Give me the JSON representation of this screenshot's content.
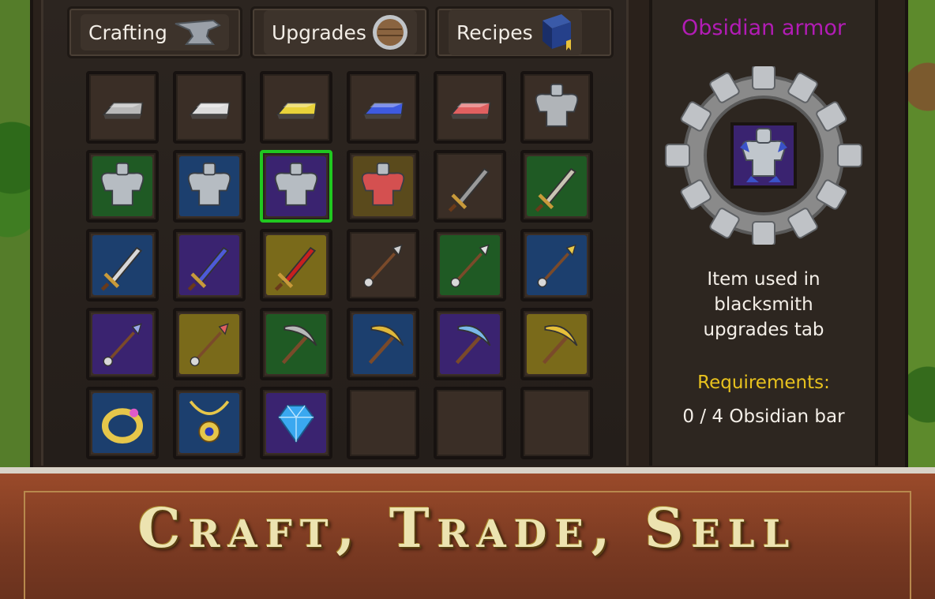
{
  "tabs": [
    {
      "label": "Crafting",
      "icon": "anvil-icon"
    },
    {
      "label": "Upgrades",
      "icon": "shield-icon"
    },
    {
      "label": "Recipes",
      "icon": "book-icon"
    }
  ],
  "grid": [
    [
      {
        "icon": "silver-bar-icon",
        "bg": "#3a2e26",
        "color": "#b8b8b8"
      },
      {
        "icon": "iron-bar-icon",
        "bg": "#3a2e26",
        "color": "#dcdcdc"
      },
      {
        "icon": "gold-bar-icon",
        "bg": "#3a2e26",
        "color": "#e8d23a"
      },
      {
        "icon": "blue-bar-icon",
        "bg": "#3a2e26",
        "color": "#3e5ae0"
      },
      {
        "icon": "red-bar-icon",
        "bg": "#3a2e26",
        "color": "#e06060"
      },
      {
        "icon": "chainmail-armor-icon",
        "bg": "#3a2e26",
        "color": "#b0b4b8"
      }
    ],
    [
      {
        "icon": "steel-armor-icon",
        "bg": "#1f5a24",
        "color": "#b6bcc2"
      },
      {
        "icon": "gold-trim-armor-icon",
        "bg": "#1c3f6e",
        "color": "#b6bcc2"
      },
      {
        "icon": "obsidian-armor-icon",
        "bg": "#3a2370",
        "color": "#b6bcc2",
        "selected": true
      },
      {
        "icon": "red-armor-icon",
        "bg": "#5a4a1c",
        "color": "#d45050"
      },
      {
        "icon": "dagger-icon",
        "bg": "#3a2e26",
        "color": "#9a9a9a"
      },
      {
        "icon": "short-sword-icon",
        "bg": "#1f5a24",
        "color": "#c9c4b4"
      }
    ],
    [
      {
        "icon": "steel-sword-icon",
        "bg": "#1c3f6e",
        "color": "#d8d8d8"
      },
      {
        "icon": "blue-sword-icon",
        "bg": "#3a2370",
        "color": "#4e5ad8"
      },
      {
        "icon": "fire-sword-icon",
        "bg": "#7a6a1a",
        "color": "#c81f1f"
      },
      {
        "icon": "bronze-spear-icon",
        "bg": "#3a2e26",
        "color": "#cfcfcf"
      },
      {
        "icon": "steel-spear-icon",
        "bg": "#1f5a24",
        "color": "#e0e0e0"
      },
      {
        "icon": "gold-spear-icon",
        "bg": "#1c3f6e",
        "color": "#e8c84a"
      }
    ],
    [
      {
        "icon": "crystal-spear-icon",
        "bg": "#3a2370",
        "color": "#9aa8e8"
      },
      {
        "icon": "ruby-spear-icon",
        "bg": "#7a6a1a",
        "color": "#e06060"
      },
      {
        "icon": "iron-pickaxe-icon",
        "bg": "#1f5a24",
        "color": "#b8b8b8"
      },
      {
        "icon": "gold-pickaxe-icon",
        "bg": "#1c3f6e",
        "color": "#e0b83a"
      },
      {
        "icon": "crystal-pickaxe-icon",
        "bg": "#3a2370",
        "color": "#7ab8e8"
      },
      {
        "icon": "ornate-pickaxe-icon",
        "bg": "#7a6a1a",
        "color": "#e6c03a"
      }
    ],
    [
      {
        "icon": "gold-ring-icon",
        "bg": "#1c3f6e",
        "color": "#e6c64a"
      },
      {
        "icon": "gold-amulet-icon",
        "bg": "#1c3f6e",
        "color": "#e6c64a"
      },
      {
        "icon": "sapphire-gem-icon",
        "bg": "#3a2370",
        "color": "#3aa8f0"
      },
      {
        "icon": "empty-slot",
        "bg": "#3a2e26",
        "color": ""
      },
      {
        "icon": "empty-slot",
        "bg": "#3a2e26",
        "color": ""
      },
      {
        "icon": "empty-slot",
        "bg": "#3a2e26",
        "color": ""
      }
    ]
  ],
  "detail": {
    "title": "Obsidian armor",
    "description": "Item used in blacksmith upgrades tab",
    "requirements_label": "Requirements:",
    "requirements_value": "0 / 4 Obsidian bar"
  },
  "banner": {
    "text": "Craft, Trade, Sell"
  }
}
